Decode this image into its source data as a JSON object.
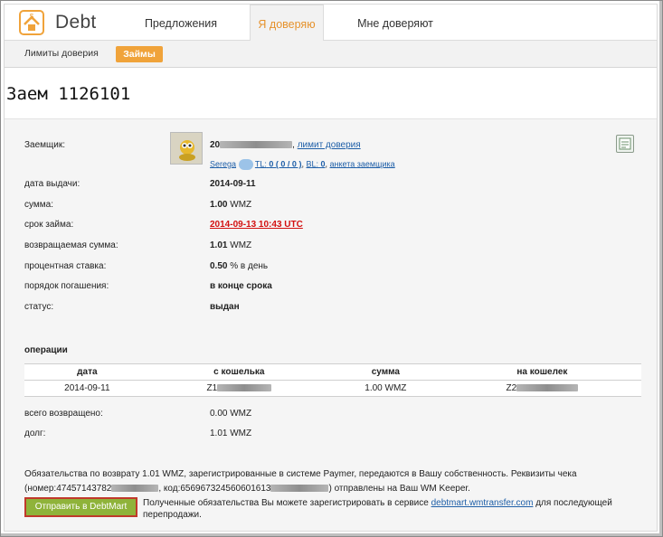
{
  "app": {
    "brand": "Debt"
  },
  "tabs": [
    "Предложения",
    "Я доверяю",
    "Мне доверяют"
  ],
  "subnav": {
    "limits": "Лимиты доверия",
    "loans": "Займы"
  },
  "page_title": "Заем 1126101",
  "borrower": {
    "label": "Заемщик:",
    "wmid_prefix": "20",
    "limit_link": "лимит доверия",
    "name": "Serega",
    "tl_label": "TL:",
    "tl_value": "0 ( 0 / 0 )",
    "bl_label": "BL:",
    "bl_value": "0",
    "profile_link": "анкета заемщика"
  },
  "fields": [
    {
      "label": "дата выдачи:",
      "value": "2014-09-11",
      "unit": ""
    },
    {
      "label": "сумма:",
      "value": "1.00",
      "unit": "WMZ"
    },
    {
      "label": "срок займа:",
      "value": "2014-09-13 10:43 UTC",
      "unit": ""
    },
    {
      "label": "возвращаемая сумма:",
      "value": "1.01",
      "unit": "WMZ"
    },
    {
      "label": "процентная ставка:",
      "value": "0.50",
      "unit": "% в день"
    },
    {
      "label": "порядок погашения:",
      "value": "в конце срока",
      "unit": ""
    },
    {
      "label": "статус:",
      "value": "выдан",
      "unit": ""
    }
  ],
  "operations": {
    "title": "операции",
    "headers": [
      "дата",
      "с кошелька",
      "сумма",
      "на кошелек"
    ],
    "rows": [
      {
        "date": "2014-09-11",
        "from": "Z1",
        "amount": "1.00 WMZ",
        "to": "Z2"
      }
    ]
  },
  "totals": {
    "returned_label": "всего возвращено:",
    "returned_value": "0.00 WMZ",
    "debt_label": "долг:",
    "debt_value": "1.01 WMZ"
  },
  "footer": {
    "line1": "Обязательства по возврату 1.01 WMZ, зарегистрированные в системе Paymer, передаются в Вашу собственность. Реквизиты чека",
    "line2_a": "(номер:47457143782",
    "line2_b": ", код:656967324560601613",
    "line2_c": ") отправлены на Ваш WM Keeper.",
    "button": "Отправить в DebtMart",
    "note_a": "Полученные обязательства Вы можете зарегистрировать в сервисе",
    "note_link": "debtmart.wmtransfer.com",
    "note_b": "для последующей перепродажи."
  },
  "colors": {
    "accent": "#f0a33a",
    "active_tab_text": "#e6922c",
    "link": "#1f5fa8",
    "deadline": "#d31010",
    "button": "#8fb33a"
  }
}
